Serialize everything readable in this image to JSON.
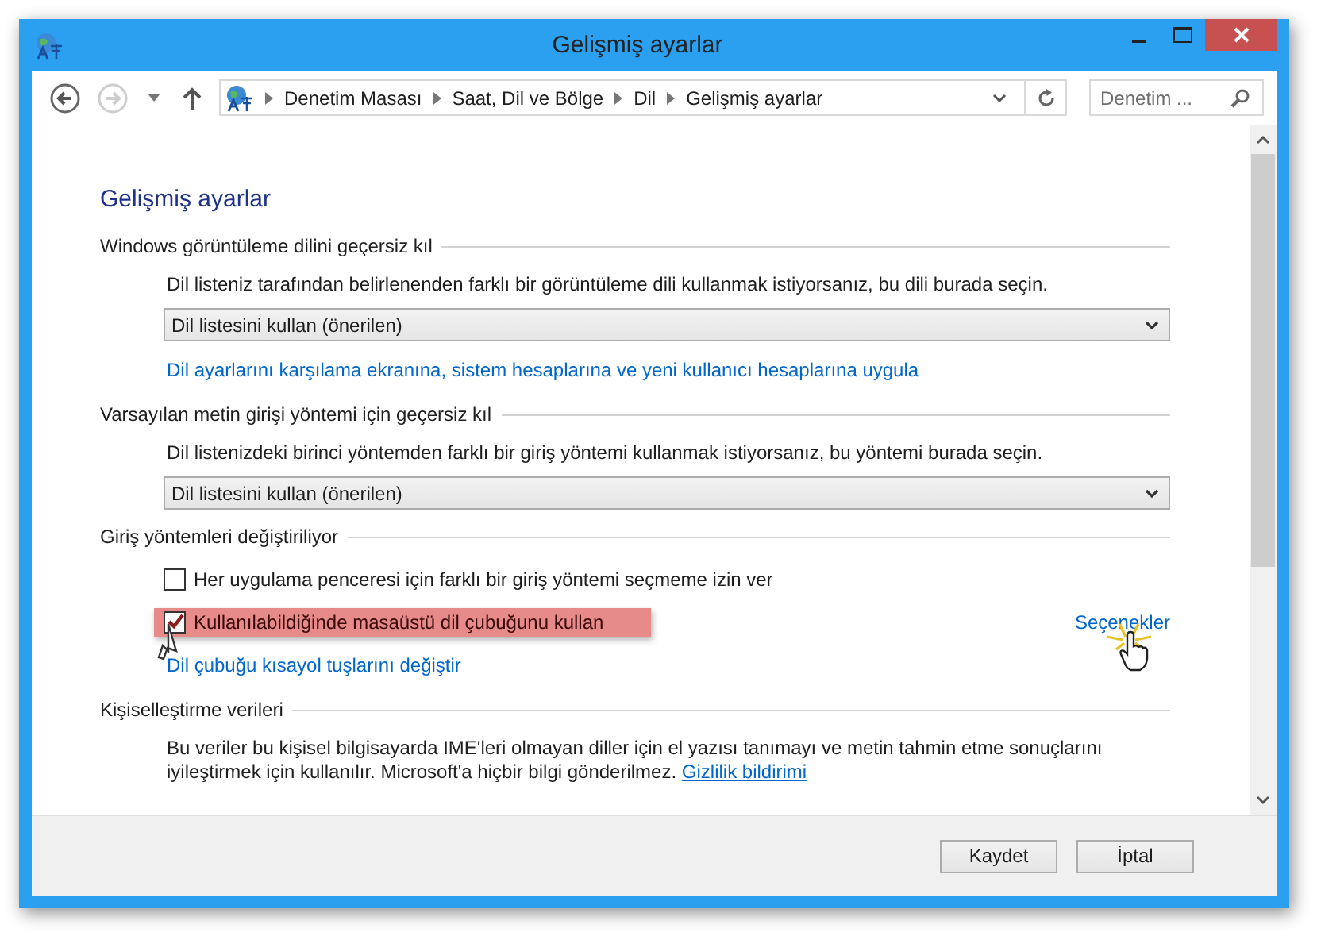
{
  "window": {
    "title": "Gelişmiş ayarlar"
  },
  "address_bar": {
    "crumbs": [
      "Denetim Masası",
      "Saat, Dil ve Bölge",
      "Dil",
      "Gelişmiş ayarlar"
    ]
  },
  "search": {
    "placeholder": "Denetim ..."
  },
  "heading": "Gelişmiş ayarlar",
  "sections": [
    {
      "kind": "dropdown",
      "title": "Windows görüntüleme dilini geçersiz kıl",
      "description": "Dil listeniz tarafından belirlenenden farklı bir görüntüleme dili kullanmak istiyorsanız, bu dili burada seçin.",
      "value": "Dil listesini kullan (önerilen)",
      "link": "Dil ayarlarını karşılama ekranına, sistem hesaplarına ve yeni kullanıcı hesaplarına uygula"
    },
    {
      "kind": "dropdown",
      "title": "Varsayılan metin girişi yöntemi için geçersiz kıl",
      "description": "Dil listenizdeki birinci yöntemden farklı bir giriş yöntemi kullanmak istiyorsanız, bu yöntemi burada seçin.",
      "value": "Dil listesini kullan (önerilen)"
    },
    {
      "kind": "checkboxes",
      "title": "Giriş yöntemleri değiştiriliyor",
      "options": [
        {
          "label": "Her uygulama penceresi için farklı bir giriş yöntemi seçmeme izin ver",
          "checked": false,
          "highlighted": false
        },
        {
          "label": "Kullanılabildiğinde masaüstü dil çubuğunu kullan",
          "checked": true,
          "highlighted": true,
          "link": "Seçenekler"
        }
      ],
      "link": "Dil çubuğu kısayol tuşlarını değiştir"
    },
    {
      "kind": "text",
      "title": "Kişiselleştirme verileri",
      "description": "Bu veriler bu kişisel bilgisayarda IME'leri olmayan diller için el yazısı tanımayı ve metin tahmin etme sonuçlarını iyileştirmek için kullanılır. Microsoft'a hiçbir bilgi gönderilmez.",
      "link": "Gizlilik bildirimi"
    }
  ],
  "buttons": [
    "Kaydet",
    "İptal"
  ]
}
